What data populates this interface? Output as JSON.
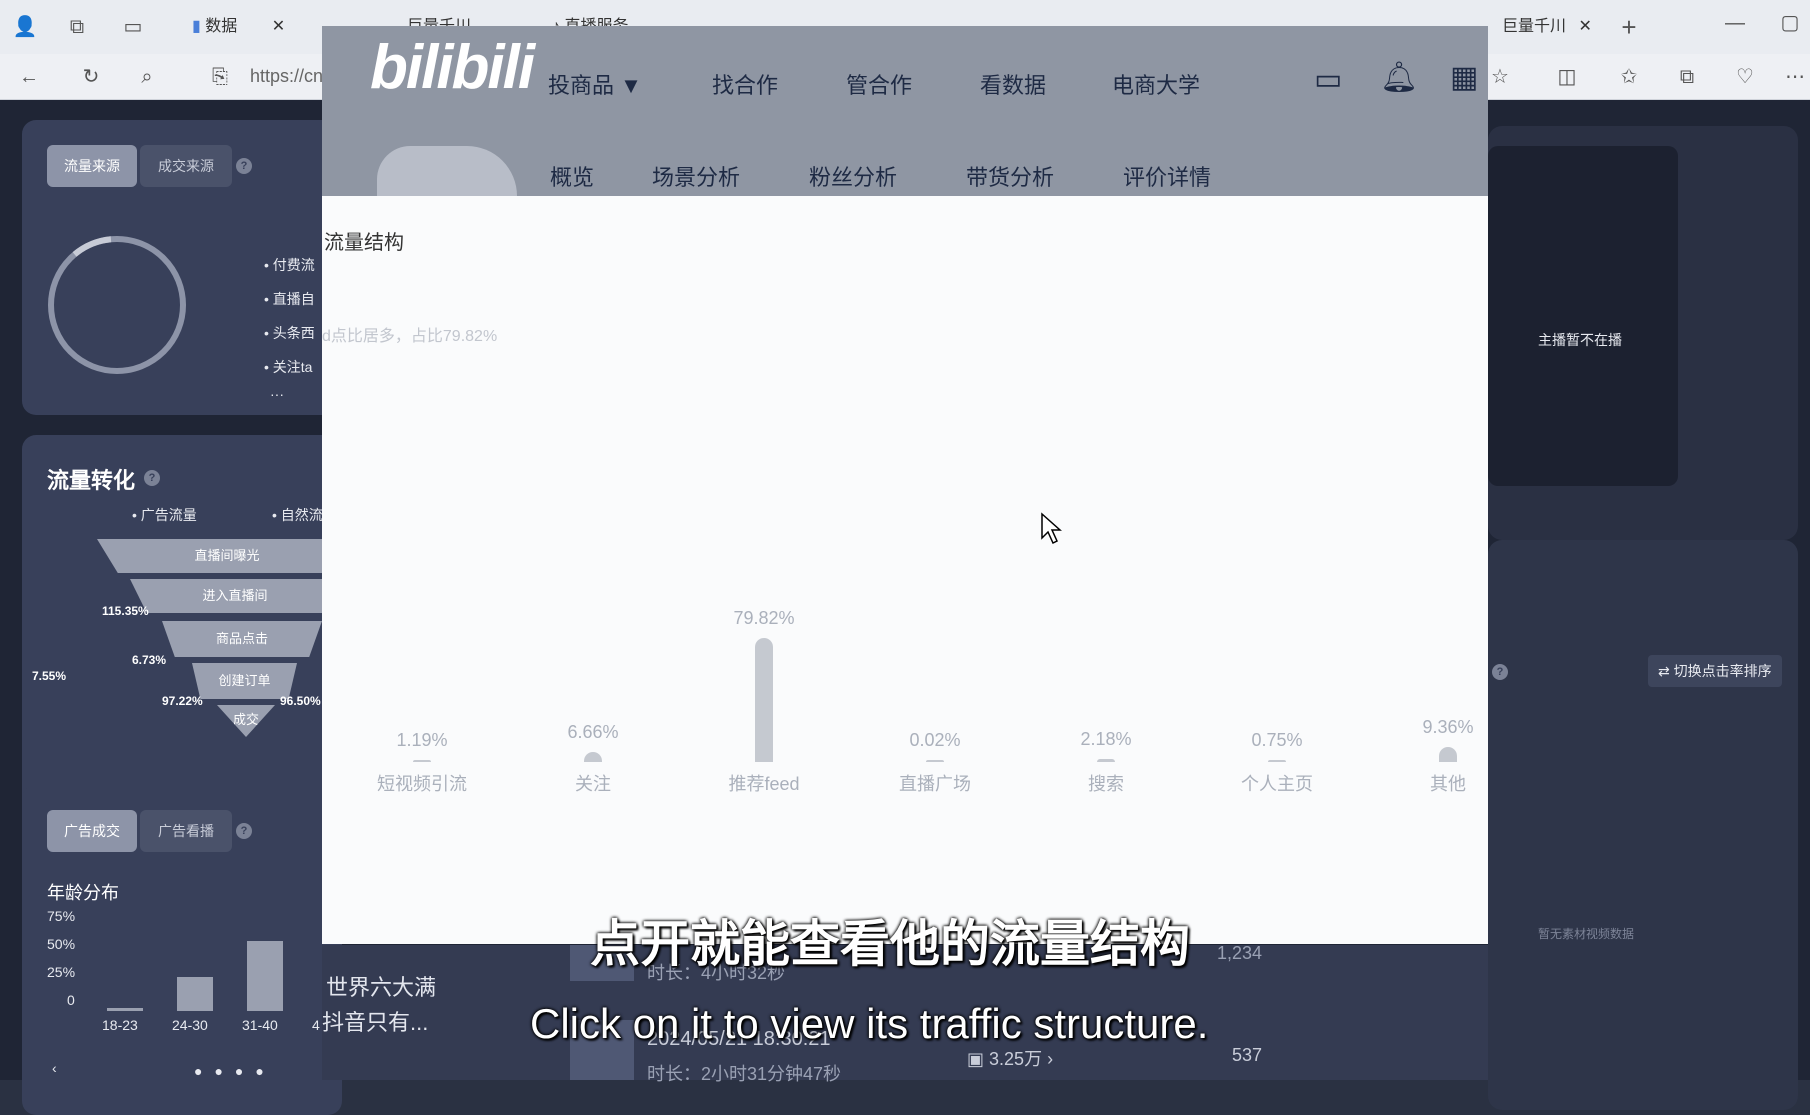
{
  "browser": {
    "tabs": [
      "数据",
      "巨量千川",
      "直播服务",
      "巨量千川"
    ],
    "address": "https://cnp"
  },
  "left_panel": {
    "tabs": [
      "流量来源",
      "成交来源"
    ],
    "legend": [
      "付费流",
      "直播自",
      "头条西",
      "关注ta"
    ],
    "more": "···",
    "conversion_title": "流量转化",
    "conv_legend": [
      "广告流量",
      "自然流"
    ],
    "funnel": [
      "直播间曝光",
      "进入直播间",
      "商品点击",
      "创建订单",
      "成交"
    ],
    "funnel_pcts": [
      "115.35%",
      "6.73%",
      "7.55%",
      "97.22%",
      "96.50%"
    ],
    "ad_tabs": [
      "广告成交",
      "广告看播"
    ],
    "age_title": "年龄分布",
    "age_y": [
      "75%",
      "50%",
      "25%",
      "0"
    ],
    "age_x": [
      "18-23",
      "24-30",
      "31-40",
      "4"
    ]
  },
  "right_panel": {
    "status": "主播暂不在播",
    "sort_button": "切换点击率排序",
    "empty": "暂无素材视频数据"
  },
  "overlay": {
    "logo": "bilibili",
    "nav": [
      "投商品",
      "找合作",
      "管合作",
      "看数据",
      "电商大学"
    ],
    "subnav": [
      "概览",
      "场景分析",
      "粉丝分析",
      "带货分析",
      "评价详情"
    ],
    "section_title": "流量结构",
    "summary": "d点比居多，占比79.82%"
  },
  "chart_data": {
    "type": "bar",
    "categories": [
      "短视频引流",
      "关注",
      "推荐feed",
      "直播广场",
      "搜索",
      "个人主页",
      "其他"
    ],
    "values": [
      1.19,
      6.66,
      79.82,
      0.02,
      2.18,
      0.75,
      9.36
    ],
    "value_labels": [
      "1.19%",
      "6.66%",
      "79.82%",
      "0.02%",
      "2.18%",
      "0.75%",
      "9.36%"
    ],
    "ylim": [
      0,
      80
    ]
  },
  "background_list": {
    "text1": "世界六大满",
    "text2": "抖音只有...",
    "item1_duration": "时长：4小时32秒",
    "item1_count": "1,234",
    "item2_date": "2024/05/21 18:30:21",
    "item2_duration": "时长：2小时31分钟47秒",
    "item2_views": "3.25万",
    "item2_count": "537"
  },
  "subtitles": {
    "cn": "点开就能查看他的流量结构",
    "en": "Click on it to view its traffic structure."
  }
}
